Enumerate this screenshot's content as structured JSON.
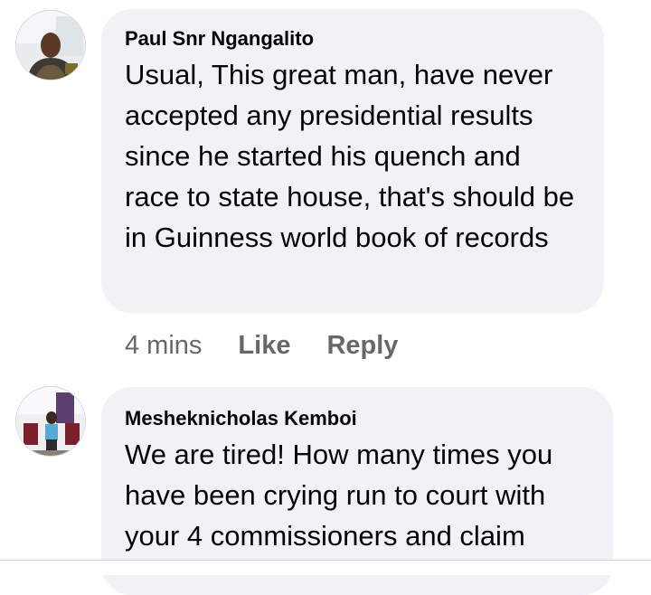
{
  "comments": [
    {
      "author": "Paul Snr Ngangalito",
      "text": "Usual, This great man, have never accepted any presidential results since he started his quench and race to state house, that's should be in Guinness world book of records",
      "time": "4 mins",
      "like_label": "Like",
      "reply_label": "Reply",
      "avatar_icon": "profile-photo-icon"
    },
    {
      "author": "Mesheknicholas Kemboi",
      "text": "We are tired! How many times you have been crying run to court with your 4 commissioners and claim",
      "avatar_icon": "profile-photo-icon"
    }
  ],
  "colors": {
    "bubble": "#f0f2f5",
    "text": "#050505",
    "secondary": "#65676b"
  }
}
